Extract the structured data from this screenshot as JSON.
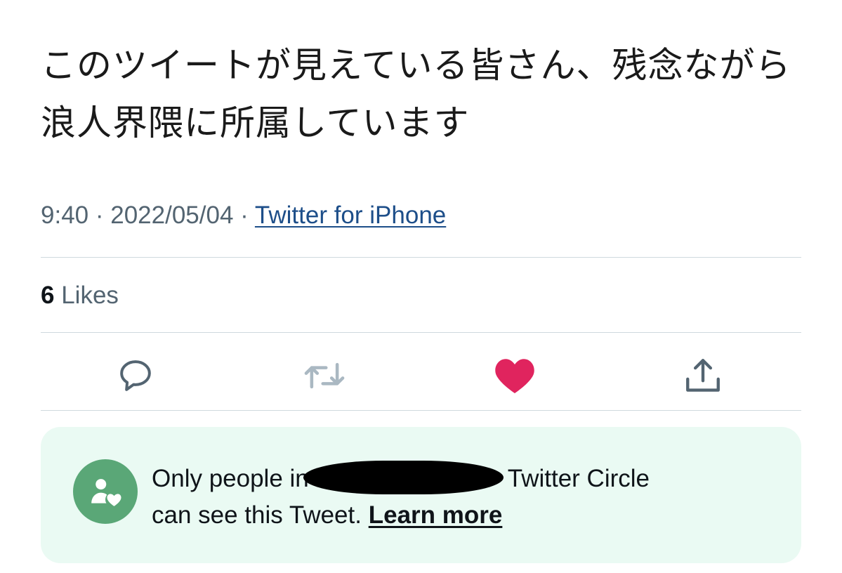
{
  "tweet": {
    "text": "このツイートが見えている皆さん、残念ながら浪人界隈に所属しています",
    "time": "9:40",
    "separator": "·",
    "date": "2022/05/04",
    "source": "Twitter for iPhone"
  },
  "stats": {
    "likes_count": "6",
    "likes_label": "Likes"
  },
  "actions": [
    {
      "name": "reply",
      "icon": "reply-icon"
    },
    {
      "name": "retweet",
      "icon": "retweet-icon"
    },
    {
      "name": "like",
      "icon": "heart-filled-icon"
    },
    {
      "name": "share",
      "icon": "share-icon"
    }
  ],
  "circle_notice": {
    "line1_prefix": "Only people in",
    "line1_suffix": "Twitter Circle",
    "line2": "can see this Tweet.",
    "learn_more": "Learn more",
    "icon": "circle-people-heart-icon"
  },
  "colors": {
    "like_active": "#e0245e",
    "icon_gray": "#536471",
    "retweet_disabled": "#aab8c2",
    "circle_bg": "#eafaf3",
    "circle_avatar": "#5aa777",
    "link": "#1d4e89"
  }
}
